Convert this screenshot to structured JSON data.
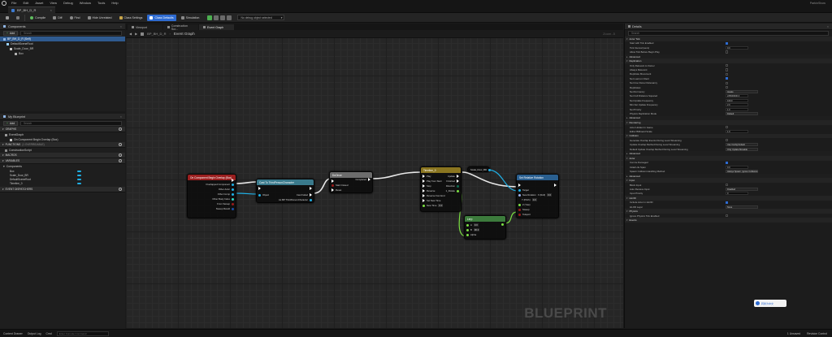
{
  "menu": {
    "items": [
      "File",
      "Edit",
      "Asset",
      "View",
      "Debug",
      "Window",
      "Tools",
      "Help"
    ],
    "project": "ParkinShow"
  },
  "asset_tab": {
    "label": "BP_BH_D_R"
  },
  "toolbar": {
    "compile": "Compile",
    "diff": "Diff",
    "find": "Find",
    "hide_unrelated": "Hide Unrelated",
    "class_settings": "Class Settings",
    "class_defaults": "Class Defaults",
    "simulation": "Simulation",
    "debug_object": "No debug object selected"
  },
  "components": {
    "title": "Components",
    "add": "Add",
    "search_placeholder": "Search",
    "tree": [
      {
        "label": "BP_BH_D_R (Self)"
      },
      {
        "label": "DefaultSceneRoot"
      },
      {
        "label": "Scale_Door_BR"
      },
      {
        "label": "Box"
      }
    ]
  },
  "my_blueprint": {
    "title": "My Blueprint",
    "add": "Add",
    "search_placeholder": "Search",
    "graphs_header": "GRAPHS",
    "eventgraph": "EventGraph",
    "eventgraph_child": "On Component Begin Overlap (Box)",
    "functions_header": "FUNCTIONS",
    "functions_count": "(1 OVERRIDABLE)",
    "construction_script": "ConstructionScript",
    "macros_header": "MACROS",
    "variables_header": "VARIABLES",
    "components_cat": "Components",
    "variables": [
      "Box",
      "Scale_Door_BR",
      "DefaultSceneRoot",
      "Timeline_0"
    ],
    "dispatchers_header": "EVENT DISPATCHERS"
  },
  "graph": {
    "tabs": [
      "Viewport",
      "Construction Scr...",
      "Event Graph"
    ],
    "crumb_root": "BP_BH_D_R",
    "crumb_title": "Event Graph",
    "zoom": "Zoom -5",
    "watermark": "BLUEPRINT"
  },
  "nodes": {
    "overlap": {
      "title": "On Component Begin Overlap (Box)",
      "pins": [
        "Overlapped Component",
        "Other Actor",
        "Other Comp",
        "Other Body Index",
        "From Sweep",
        "Sweep Result"
      ]
    },
    "cast": {
      "title": "Cast To ThirdPersonCharacter",
      "pins": [
        "Object",
        "Cast Failed",
        "As BP ThirdPersonCharacter"
      ]
    },
    "doonce": {
      "title": "DoOnce",
      "pins": [
        "Start Closed",
        "Reset",
        "Completed"
      ]
    },
    "timeline": {
      "title": "Timeline_0",
      "pins": [
        "Play",
        "Play from Start",
        "Stop",
        "Reverse",
        "Reverse from End",
        "Set New Time",
        "New Time",
        "Update",
        "Finished",
        "Direction",
        "1_Rotate"
      ],
      "new_time_value": "0.0"
    },
    "target_scene": {
      "title": "Scale_Door_BR"
    },
    "setrot": {
      "title": "Set Relative Rotation",
      "pins": [
        "Target",
        "New Rotation",
        "X (Roll)",
        "Y (Pitch)",
        "Z (Yaw)",
        "Sweep",
        "Teleport"
      ],
      "roll": "0.0",
      "pitch": "0.0",
      "sweep": "Sweep",
      "teleport": "Teleport"
    },
    "lerp": {
      "title": "Lerp",
      "pins": [
        "A",
        "B",
        "Alpha"
      ],
      "a": "0.0",
      "b": "90.0"
    }
  },
  "details": {
    "title": "Details",
    "search_placeholder": "Search",
    "sections": [
      {
        "type": "section",
        "label": "Actor Tick"
      },
      {
        "type": "check",
        "label": "Start with Tick Enabled",
        "on": true
      },
      {
        "type": "field",
        "label": "Tick Interval (secs)",
        "value": "0.0"
      },
      {
        "type": "check",
        "label": "Allow Tick Before Begin Play",
        "on": false
      },
      {
        "type": "sub",
        "label": "Advanced"
      },
      {
        "type": "section",
        "label": "Replication"
      },
      {
        "type": "check",
        "label": "Only Relevant to Owner",
        "on": false
      },
      {
        "type": "check",
        "label": "Always Relevant",
        "on": false
      },
      {
        "type": "check",
        "label": "Replicate Movement",
        "on": false
      },
      {
        "type": "check",
        "label": "Net Load on Client",
        "on": true
      },
      {
        "type": "check",
        "label": "Net Use Owner Relevancy",
        "on": false
      },
      {
        "type": "check",
        "label": "Replicates",
        "on": false
      },
      {
        "type": "select",
        "label": "Net Dormancy",
        "value": "Awake"
      },
      {
        "type": "field",
        "label": "Net Cull Distance Squared",
        "value": "225000000.0"
      },
      {
        "type": "field",
        "label": "Net Update Frequency",
        "value": "100.0"
      },
      {
        "type": "field",
        "label": "Min Net Update Frequency",
        "value": "2.0"
      },
      {
        "type": "field",
        "label": "Net Priority",
        "value": "1.0"
      },
      {
        "type": "select",
        "label": "Physics Replication Mode",
        "value": "Default"
      },
      {
        "type": "sub",
        "label": "Advanced"
      },
      {
        "type": "section",
        "label": "Rendering"
      },
      {
        "type": "check",
        "label": "Actor Hidden In Game",
        "on": false
      },
      {
        "type": "field",
        "label": "Editor Billboard Scale",
        "value": "1.0"
      },
      {
        "type": "section",
        "label": "Collision"
      },
      {
        "type": "check",
        "label": "Generate Overlap Events During Level Streaming",
        "on": false
      },
      {
        "type": "select",
        "label": "Update Overlap Method During Level Streaming",
        "value": "Use Config Default"
      },
      {
        "type": "select",
        "label": "Default Update Overlap Method During Level Streaming",
        "value": "Only Update Movable"
      },
      {
        "type": "sub",
        "label": "Advanced"
      },
      {
        "type": "section",
        "label": "Actor"
      },
      {
        "type": "check",
        "label": "Can be Damaged",
        "on": true
      },
      {
        "type": "field",
        "label": "Initial Life Span",
        "value": "0.0"
      },
      {
        "type": "select",
        "label": "Spawn Collision Handling Method",
        "value": "Always Spawn, Ignore Collisions"
      },
      {
        "type": "sub",
        "label": "Advanced"
      },
      {
        "type": "section",
        "label": "Input"
      },
      {
        "type": "check",
        "label": "Block Input",
        "on": false
      },
      {
        "type": "select",
        "label": "Auto Receive Input",
        "value": "Disabled"
      },
      {
        "type": "field",
        "label": "Input Priority",
        "value": "0"
      },
      {
        "type": "section",
        "label": "HLOD"
      },
      {
        "type": "check",
        "label": "Include Actor in HLOD",
        "on": true
      },
      {
        "type": "select",
        "label": "HLOD Layer",
        "value": "None"
      },
      {
        "type": "section",
        "label": "Physics"
      },
      {
        "type": "check",
        "label": "Ignore Physics Tick Enabled",
        "on": false
      },
      {
        "type": "section",
        "label": "Events"
      }
    ]
  },
  "translate_badge": "转换为中文",
  "status": {
    "content_drawer": "Content Drawer",
    "output_log": "Output Log",
    "cmd": "Cmd",
    "cmd_placeholder": "Enter Console Command",
    "unsaved": "1 Unsaved",
    "revision": "Revision Control"
  },
  "colors": {
    "accent": "#2e6bd1",
    "event_head": "#9a1f1f",
    "pure_head": "#3a7a8c",
    "exec_head": "#6c6c6c",
    "timeline_head": "#8a7520",
    "function_head": "#2a5f8f",
    "math_head": "#3c7b3c"
  }
}
